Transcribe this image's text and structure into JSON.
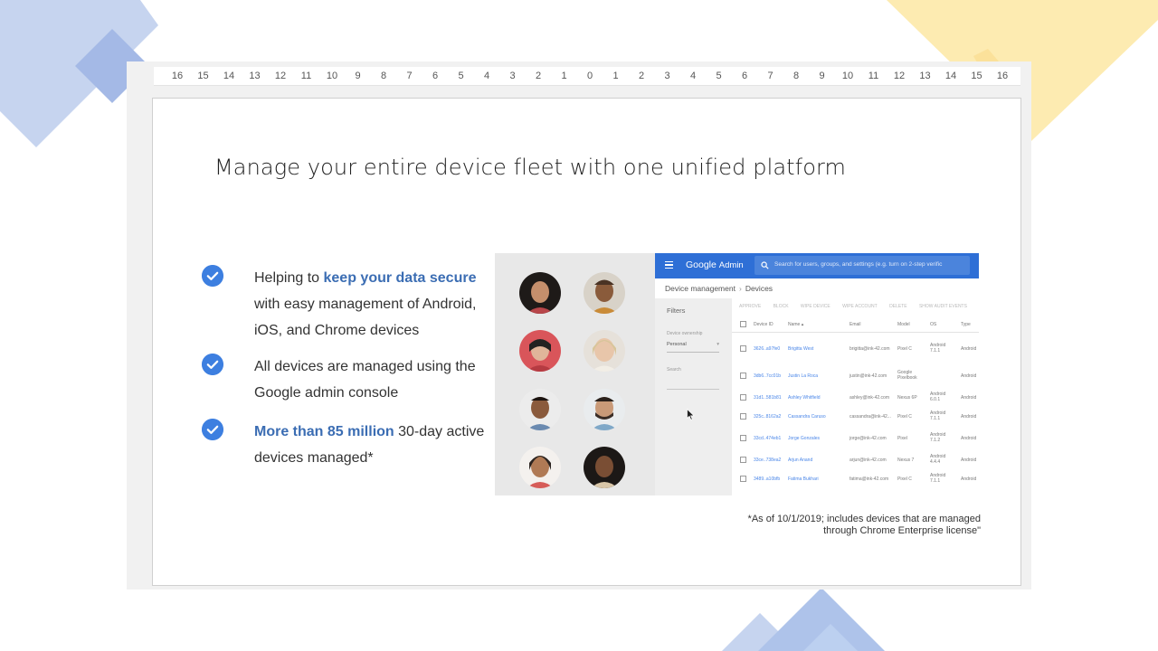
{
  "ruler": {
    "ticks": [
      "16",
      "15",
      "14",
      "13",
      "12",
      "11",
      "10",
      "9",
      "8",
      "7",
      "6",
      "5",
      "4",
      "3",
      "2",
      "1",
      "0",
      "1",
      "2",
      "3",
      "4",
      "5",
      "6",
      "7",
      "8",
      "9",
      "10",
      "11",
      "12",
      "13",
      "14",
      "15",
      "16"
    ]
  },
  "slide": {
    "title": "Manage your entire device fleet with one unified platform",
    "bullets": [
      {
        "pre": "Helping to ",
        "highlight": "keep your data secure",
        "post": " with easy management of Android, iOS, and Chrome devices"
      },
      {
        "pre": "All devices are managed using the Google admin console",
        "highlight": "",
        "post": ""
      },
      {
        "pre": "",
        "highlight": "More than 85 million",
        "post": " 30-day active devices managed*"
      }
    ],
    "footnote_line1": "*As of 10/1/2019; includes devices that are managed",
    "footnote_line2": "through Chrome Enterprise license\""
  },
  "admin": {
    "logo_google": "Google",
    "logo_admin": "Admin",
    "search_placeholder": "Search for users, groups, and settings (e.g. turn on 2-step verific",
    "breadcrumb_parent": "Device management",
    "breadcrumb_current": "Devices",
    "filters_title": "Filters",
    "filter_ownership_label": "Device ownership",
    "filter_ownership_value": "Personal",
    "filter_search_label": "Search",
    "actions": [
      "APPROVE",
      "BLOCK",
      "WIPE DEVICE",
      "WIPE ACCOUNT",
      "DELETE",
      "SHOW AUDIT EVENTS"
    ],
    "columns": [
      "Device ID",
      "Name ▴",
      "Email",
      "Model",
      "OS",
      "Type"
    ],
    "rows": [
      {
        "id": "3626..a97fe0",
        "name": "Brigitta West",
        "email": "brigitta@ink-42.com",
        "model": "Pixel C",
        "os": "Android 7.1.1",
        "type": "Android"
      },
      {
        "id": "3db6..7cc01b",
        "name": "Justin La Roca",
        "email": "justin@ink-42.com",
        "model": "Google Pixelbook",
        "os": "",
        "type": "Android"
      },
      {
        "id": "31d1..581b81",
        "name": "Ashley Whitfield",
        "email": "ashley@ink-42.com",
        "model": "Nexus 6P",
        "os": "Android 6.0.1",
        "type": "Android"
      },
      {
        "id": "325c..8162a2",
        "name": "Cassandra Caruso",
        "email": "cassandra@ink-42...",
        "model": "Pixel C",
        "os": "Android 7.1.1",
        "type": "Android"
      },
      {
        "id": "33cd..474eb1",
        "name": "Jorge Gonzales",
        "email": "jorge@ink-42.com",
        "model": "Pixel",
        "os": "Android 7.1.2",
        "type": "Android"
      },
      {
        "id": "33ce..738ea2",
        "name": "Arjun Anand",
        "email": "arjun@ink-42.com",
        "model": "Nexus 7",
        "os": "Android 4.4.4",
        "type": "Android"
      },
      {
        "id": "3489..a10bfb",
        "name": "Fatima Bukhari",
        "email": "fatima@ink-42.com",
        "model": "Pixel C",
        "os": "Android 7.1.1",
        "type": "Android"
      }
    ]
  },
  "colors": {
    "accent": "#3d7fe0",
    "highlight_text": "#3b6db3",
    "admin_bar": "#2e6fd6"
  }
}
